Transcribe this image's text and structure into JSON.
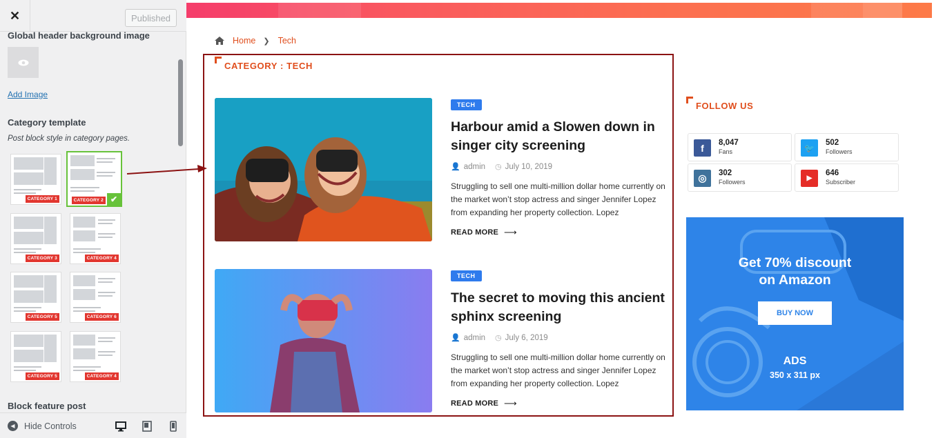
{
  "customizer": {
    "close_label": "✕",
    "published_label": "Published",
    "global_header_bg_title": "Global header background image",
    "add_image_label": "Add Image",
    "category_template_title": "Category template",
    "category_template_desc": "Post block style in category pages.",
    "templates": [
      {
        "label": "CATEGORY 1",
        "selected": false
      },
      {
        "label": "CATEGORY 2",
        "selected": true
      },
      {
        "label": "CATEGORY 3",
        "selected": false
      },
      {
        "label": "CATEGORY 4",
        "selected": false
      },
      {
        "label": "CATEGORY 5",
        "selected": false
      },
      {
        "label": "CATEGORY 6",
        "selected": false
      },
      {
        "label": "CATEGORY 5",
        "selected": false
      },
      {
        "label": "CATEGORY 4",
        "selected": false
      }
    ],
    "block_feature_post_title": "Block feature post",
    "hide_controls_label": "Hide Controls",
    "devices": [
      "desktop-icon",
      "tablet-icon",
      "mobile-icon"
    ]
  },
  "preview": {
    "breadcrumb": {
      "home": "Home",
      "current": "Tech"
    },
    "category_heading": "CATEGORY : TECH",
    "posts": [
      {
        "tag": "TECH",
        "title": "Harbour amid a Slowen down in singer city screening",
        "author": "admin",
        "date": "July 10, 2019",
        "excerpt": "Struggling to sell one multi-million dollar home currently on the market won’t stop actress and singer Jennifer Lopez from expanding her property collection. Lopez",
        "read_more": "READ MORE"
      },
      {
        "tag": "TECH",
        "title": "The secret to moving this ancient sphinx screening",
        "author": "admin",
        "date": "July 6, 2019",
        "excerpt": "Struggling to sell one multi-million dollar home currently on the market won’t stop actress and singer Jennifer Lopez from expanding her property collection. Lopez",
        "read_more": "READ MORE"
      }
    ],
    "follow_us": {
      "heading": "FOLLOW US",
      "items": [
        {
          "network": "facebook",
          "icon": "facebook-icon",
          "count": "8,047",
          "label": "Fans",
          "color": "#3b5998"
        },
        {
          "network": "twitter",
          "icon": "twitter-icon",
          "count": "502",
          "label": "Followers",
          "color": "#1da1f2"
        },
        {
          "network": "instagram",
          "icon": "instagram-icon",
          "count": "302",
          "label": "Followers",
          "color": "#3f729b"
        },
        {
          "network": "youtube",
          "icon": "youtube-icon",
          "count": "646",
          "label": "Subscriber",
          "color": "#e52d27"
        }
      ]
    },
    "ad": {
      "line1": "Get 70% discount",
      "line2": "on Amazon",
      "button": "BUY NOW",
      "label": "ADS",
      "size": "350 x 311 px"
    }
  },
  "colors": {
    "accent": "#e04e1d",
    "tag_blue": "#2e7bed",
    "annotation_border": "#8b1212",
    "selected_green": "#67c23a"
  }
}
